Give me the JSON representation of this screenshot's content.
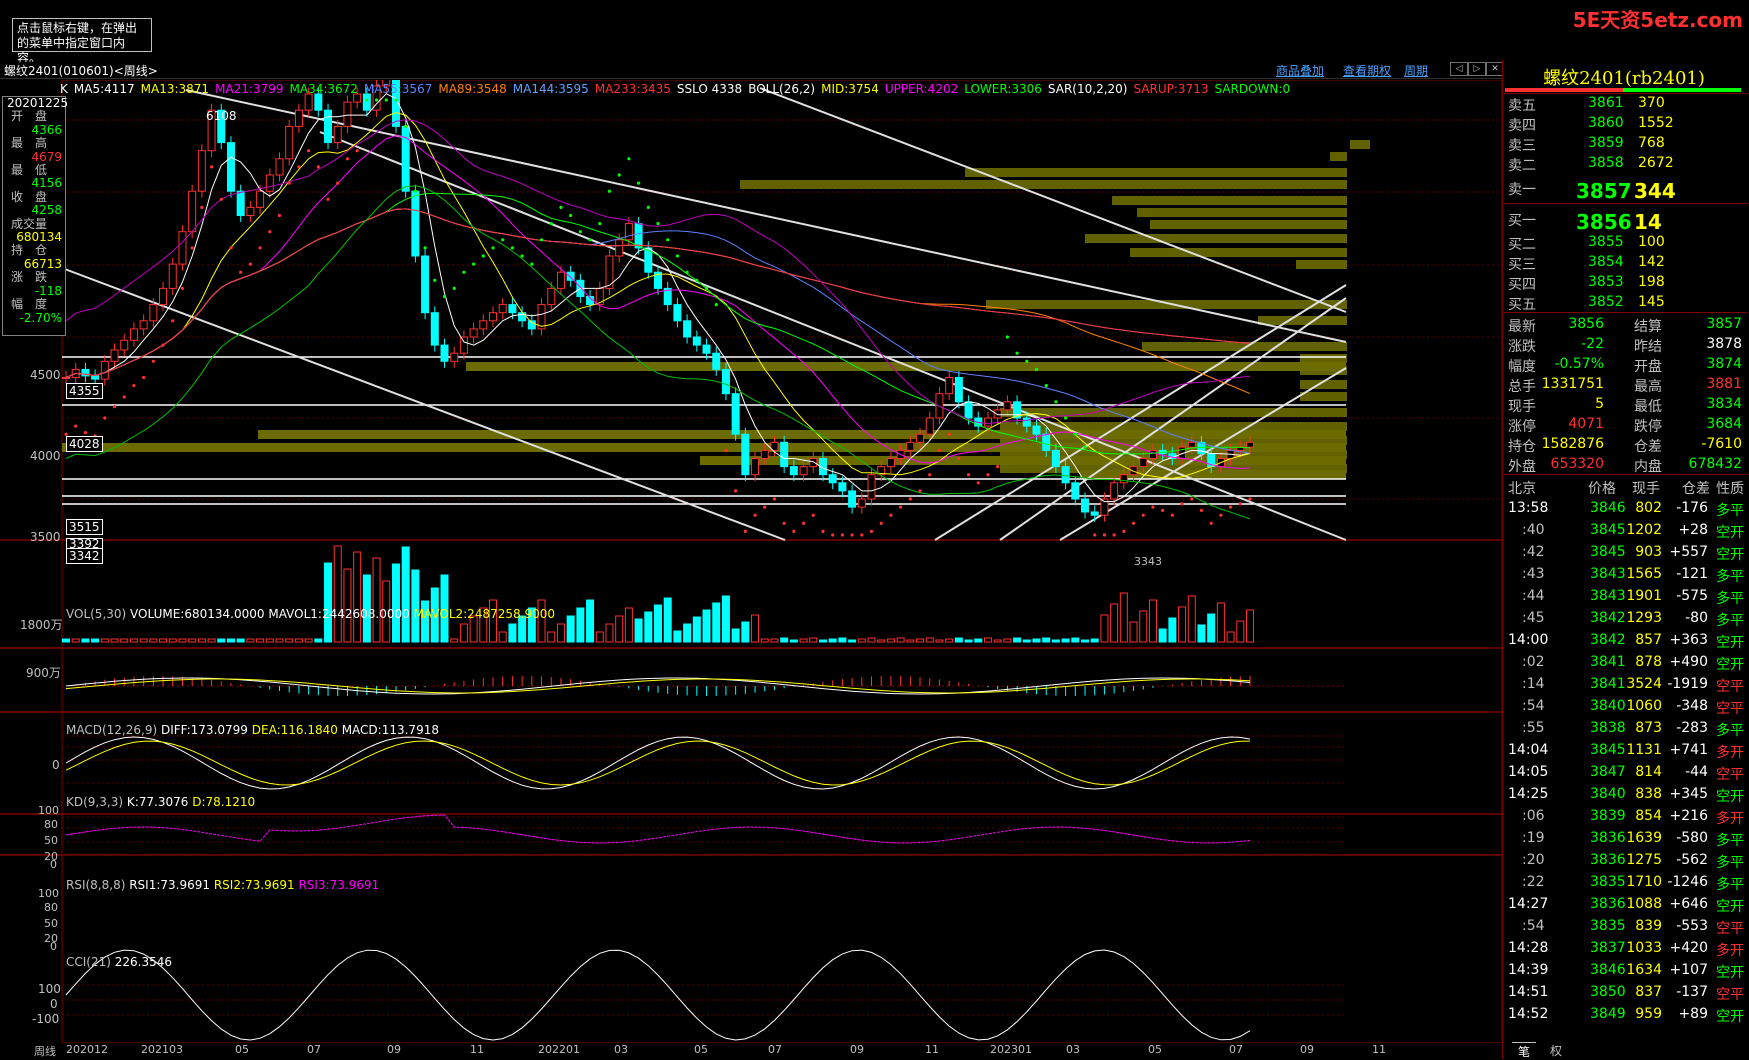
{
  "window": {
    "tooltip": "点击鼠标右键，在弹出的菜单中指定窗口内容。",
    "watermark": "5E天资5etz.com",
    "code": "螺纹2401(010601)<周线>",
    "links": [
      "商品叠加",
      "查看期权",
      "周期"
    ]
  },
  "indicator_line": [
    {
      "t": "K",
      "c": "#ffffff"
    },
    {
      "t": "MA5:4117",
      "c": "#ffffff"
    },
    {
      "t": "MA13:3871",
      "c": "#ffff00"
    },
    {
      "t": "MA21:3799",
      "c": "#ff00ff"
    },
    {
      "t": "MA34:3672",
      "c": "#00ff00"
    },
    {
      "t": "MA55:3567",
      "c": "#6080ff"
    },
    {
      "t": "MA89:3548",
      "c": "#ff8000"
    },
    {
      "t": "MA144:3595",
      "c": "#60a0ff"
    },
    {
      "t": "MA233:3435",
      "c": "#ff3030"
    },
    {
      "t": "SSLO 4338",
      "c": "#ffffff"
    },
    {
      "t": "BOLL(26,2)",
      "c": "#ffffff"
    },
    {
      "t": "MID:3754",
      "c": "#ffff00"
    },
    {
      "t": "UPPER:4202",
      "c": "#ff00ff"
    },
    {
      "t": "LOWER:3306",
      "c": "#00ff00"
    },
    {
      "t": "SAR(10,2,20)",
      "c": "#ffffff"
    },
    {
      "t": "SARUP:3713",
      "c": "#ff3030"
    },
    {
      "t": "SARDOWN:0",
      "c": "#00ff00"
    }
  ],
  "infobox": {
    "date": "20201225",
    "open_label": "开　盘",
    "open": "4366",
    "high_label": "最　高",
    "high": "4679",
    "low_label": "最　低",
    "low": "4156",
    "close_label": "收　盘",
    "close": "4258",
    "vol_label": "成交量",
    "vol": "680134",
    "oi_label": "持　仓",
    "oi": "66713",
    "chg_label": "涨　跌",
    "chg": "-118",
    "pct_label": "幅　度",
    "pct": "-2.70%"
  },
  "price_axis": {
    "labels": [
      "4500",
      "4000",
      "3500"
    ],
    "boxes": [
      "4355",
      "4028",
      "3515",
      "3392",
      "3342"
    ],
    "peak_label": "6108",
    "low_label": "3343"
  },
  "panels": {
    "vol": {
      "head": [
        "VOL(5,30)",
        "VOLUME:680134.0000",
        "MAVOL1:2442608.0000",
        "MAVOL2:2487258.9000"
      ],
      "axis": [
        "1800万",
        "900万"
      ]
    },
    "macd": {
      "head": [
        "MACD(12,26,9)",
        "DIFF:173.0799",
        "DEA:116.1840",
        "MACD:113.7918"
      ],
      "axis": [
        "0"
      ]
    },
    "kd": {
      "head": [
        "KD(9,3,3)",
        "K:77.3076",
        "D:78.1210"
      ],
      "axis": [
        "100",
        "80",
        "50",
        "20",
        "0"
      ]
    },
    "rsi": {
      "head": [
        "RSI(8,8,8)",
        "RSI1:73.9691",
        "RSI2:73.9691",
        "RSI3:73.9691"
      ],
      "axis": [
        "100",
        "80",
        "50",
        "20",
        "0"
      ]
    },
    "cci": {
      "head": [
        "CCI(21)",
        "226.3546"
      ],
      "axis": [
        "100",
        "0",
        "-100"
      ]
    }
  },
  "time_axis": {
    "label": "周线",
    "ticks": [
      "202012",
      "202103",
      "05",
      "07",
      "09",
      "11",
      "202201",
      "03",
      "05",
      "07",
      "09",
      "11",
      "202301",
      "03",
      "05",
      "07",
      "09",
      "11"
    ]
  },
  "quote": {
    "title": "螺纹2401(rb2401)",
    "asks": [
      {
        "l": "卖五",
        "p": "3861",
        "v": "370"
      },
      {
        "l": "卖四",
        "p": "3860",
        "v": "1552"
      },
      {
        "l": "卖三",
        "p": "3859",
        "v": "768"
      },
      {
        "l": "卖二",
        "p": "3858",
        "v": "2672"
      },
      {
        "l": "卖一",
        "p": "3857",
        "v": "344"
      }
    ],
    "bids": [
      {
        "l": "买一",
        "p": "3856",
        "v": "14"
      },
      {
        "l": "买二",
        "p": "3855",
        "v": "100"
      },
      {
        "l": "买三",
        "p": "3854",
        "v": "142"
      },
      {
        "l": "买四",
        "p": "3853",
        "v": "198"
      },
      {
        "l": "买五",
        "p": "3852",
        "v": "145"
      }
    ],
    "stats": [
      {
        "l1": "最新",
        "v1": "3856",
        "c1": "#00ff00",
        "l2": "结算",
        "v2": "3857",
        "c2": "#00ff00"
      },
      {
        "l1": "涨跌",
        "v1": "-22",
        "c1": "#00ff00",
        "l2": "昨结",
        "v2": "3878",
        "c2": "#ffffff"
      },
      {
        "l1": "幅度",
        "v1": "-0.57%",
        "c1": "#00ff00",
        "l2": "开盘",
        "v2": "3874",
        "c2": "#00ff00"
      },
      {
        "l1": "总手",
        "v1": "1331751",
        "c1": "#ffff00",
        "l2": "最高",
        "v2": "3881",
        "c2": "#ff3030"
      },
      {
        "l1": "现手",
        "v1": "5",
        "c1": "#ffff00",
        "l2": "最低",
        "v2": "3834",
        "c2": "#00ff00"
      },
      {
        "l1": "涨停",
        "v1": "4071",
        "c1": "#ff3030",
        "l2": "跌停",
        "v2": "3684",
        "c2": "#00ff00"
      },
      {
        "l1": "持仓",
        "v1": "1582876",
        "c1": "#ffff00",
        "l2": "仓差",
        "v2": "-7610",
        "c2": "#ffff00"
      },
      {
        "l1": "外盘",
        "v1": "653320",
        "c1": "#ff3030",
        "l2": "内盘",
        "v2": "678432",
        "c2": "#00ff00"
      }
    ],
    "tick_header": [
      "北京",
      "价格",
      "现手",
      "仓差",
      "性质"
    ],
    "ticks": [
      {
        "t": "13:58",
        "p": "3846",
        "v": "802",
        "d": "-176",
        "k": "多平",
        "kc": "#00ff00",
        "tw": true
      },
      {
        "t": ":40",
        "p": "3845",
        "v": "1202",
        "d": "+28",
        "k": "空开",
        "kc": "#00ff00",
        "tw": false
      },
      {
        "t": ":42",
        "p": "3845",
        "v": "903",
        "d": "+557",
        "k": "空开",
        "kc": "#00ff00",
        "tw": false
      },
      {
        "t": ":43",
        "p": "3843",
        "v": "1565",
        "d": "-121",
        "k": "多平",
        "kc": "#00ff00",
        "tw": false
      },
      {
        "t": ":44",
        "p": "3843",
        "v": "1901",
        "d": "-575",
        "k": "多平",
        "kc": "#00ff00",
        "tw": false
      },
      {
        "t": ":45",
        "p": "3842",
        "v": "1293",
        "d": "-80",
        "k": "多平",
        "kc": "#00ff00",
        "tw": false
      },
      {
        "t": "14:00",
        "p": "3842",
        "v": "857",
        "d": "+363",
        "k": "空开",
        "kc": "#00ff00",
        "tw": true
      },
      {
        "t": ":02",
        "p": "3841",
        "v": "878",
        "d": "+490",
        "k": "空开",
        "kc": "#00ff00",
        "tw": false
      },
      {
        "t": ":14",
        "p": "3841",
        "v": "3524",
        "d": "-1919",
        "k": "空平",
        "kc": "#ff3030",
        "tw": false
      },
      {
        "t": ":54",
        "p": "3840",
        "v": "1060",
        "d": "-348",
        "k": "空平",
        "kc": "#ff3030",
        "tw": false
      },
      {
        "t": ":55",
        "p": "3838",
        "p_c": "g",
        "v": "873",
        "d": "-283",
        "k": "多平",
        "kc": "#00ff00",
        "tw": false
      },
      {
        "t": "14:04",
        "p": "3845",
        "v": "1131",
        "d": "+741",
        "k": "多开",
        "kc": "#ff3030",
        "tw": true
      },
      {
        "t": "14:05",
        "p": "3847",
        "v": "814",
        "d": "-44",
        "k": "空平",
        "kc": "#ff3030",
        "tw": true
      },
      {
        "t": "14:25",
        "p": "3840",
        "v": "838",
        "d": "+345",
        "k": "空开",
        "kc": "#00ff00",
        "tw": true
      },
      {
        "t": ":06",
        "p": "3839",
        "v": "854",
        "d": "+216",
        "k": "多开",
        "kc": "#ff3030",
        "tw": false
      },
      {
        "t": ":19",
        "p": "3836",
        "v": "1639",
        "d": "-580",
        "k": "多平",
        "kc": "#00ff00",
        "tw": false
      },
      {
        "t": ":20",
        "p": "3836",
        "v": "1275",
        "d": "-562",
        "k": "多平",
        "kc": "#00ff00",
        "tw": false
      },
      {
        "t": ":22",
        "p": "3835",
        "v": "1710",
        "d": "-1246",
        "k": "多平",
        "kc": "#00ff00",
        "tw": false
      },
      {
        "t": "14:27",
        "p": "3836",
        "v": "1088",
        "d": "+646",
        "k": "空开",
        "kc": "#00ff00",
        "tw": true
      },
      {
        "t": ":54",
        "p": "3835",
        "v": "839",
        "d": "-553",
        "k": "空平",
        "kc": "#ff3030",
        "tw": false
      },
      {
        "t": "14:28",
        "p": "3837",
        "v": "1033",
        "d": "+420",
        "k": "多开",
        "kc": "#ff3030",
        "tw": true
      },
      {
        "t": "14:39",
        "p": "3846",
        "v": "1634",
        "d": "+107",
        "k": "空开",
        "kc": "#00ff00",
        "tw": true
      },
      {
        "t": "14:51",
        "p": "3850",
        "v": "837",
        "d": "-137",
        "k": "空平",
        "kc": "#ff3030",
        "tw": true
      },
      {
        "t": "14:52",
        "p": "3849",
        "v": "959",
        "d": "+89",
        "k": "空开",
        "kc": "#00ff00",
        "tw": true
      }
    ],
    "tabs": [
      "笔",
      "权"
    ]
  }
}
